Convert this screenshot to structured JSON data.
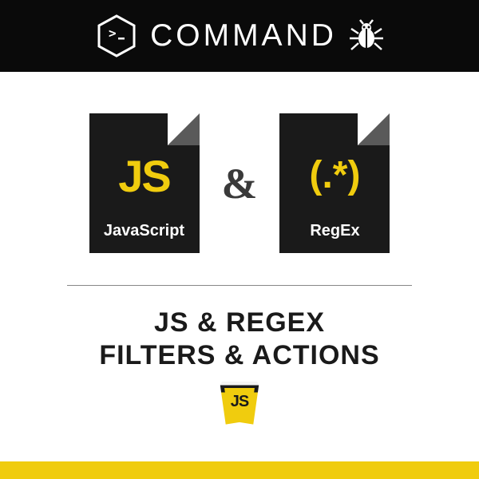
{
  "header": {
    "title": "COMMAND"
  },
  "icons": {
    "js": {
      "big": "JS",
      "label": "JavaScript"
    },
    "regex": {
      "big": "(.*)",
      "label": "RegEx"
    },
    "ampersand": "&"
  },
  "heading": {
    "line1": "JS & REGEX",
    "line2": "FILTERS & ACTIONS"
  },
  "badge": {
    "text": "JS"
  },
  "colors": {
    "accent": "#f0cc0e",
    "dark": "#1a1a1a"
  }
}
